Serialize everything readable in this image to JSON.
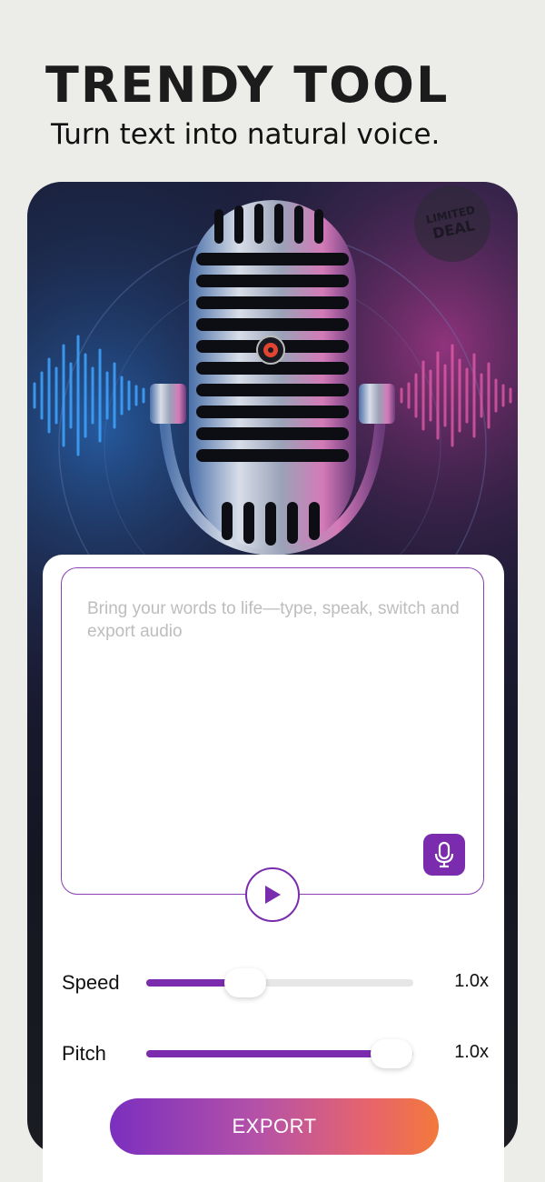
{
  "header": {
    "title": "TRENDY TOOL",
    "subtitle": "Turn text into natural voice."
  },
  "hero": {
    "image_name": "studio-microphone-illustration",
    "stamp_text": "LIMITED DEAL"
  },
  "editor": {
    "placeholder": "Bring your words to life—type, speak, switch and export audio",
    "mic_icon": "microphone-icon",
    "play_icon": "play-icon"
  },
  "controls": {
    "speed": {
      "label": "Speed",
      "value": "1.0x",
      "level": 0.37
    },
    "pitch": {
      "label": "Pitch",
      "value": "1.0x",
      "level": 0.92
    }
  },
  "export": {
    "label": "EXPORT"
  },
  "colors": {
    "accent": "#7b2cae",
    "background": "#ecede9",
    "export_gradient_start": "#7b2fbf",
    "export_gradient_end": "#f2793b"
  }
}
